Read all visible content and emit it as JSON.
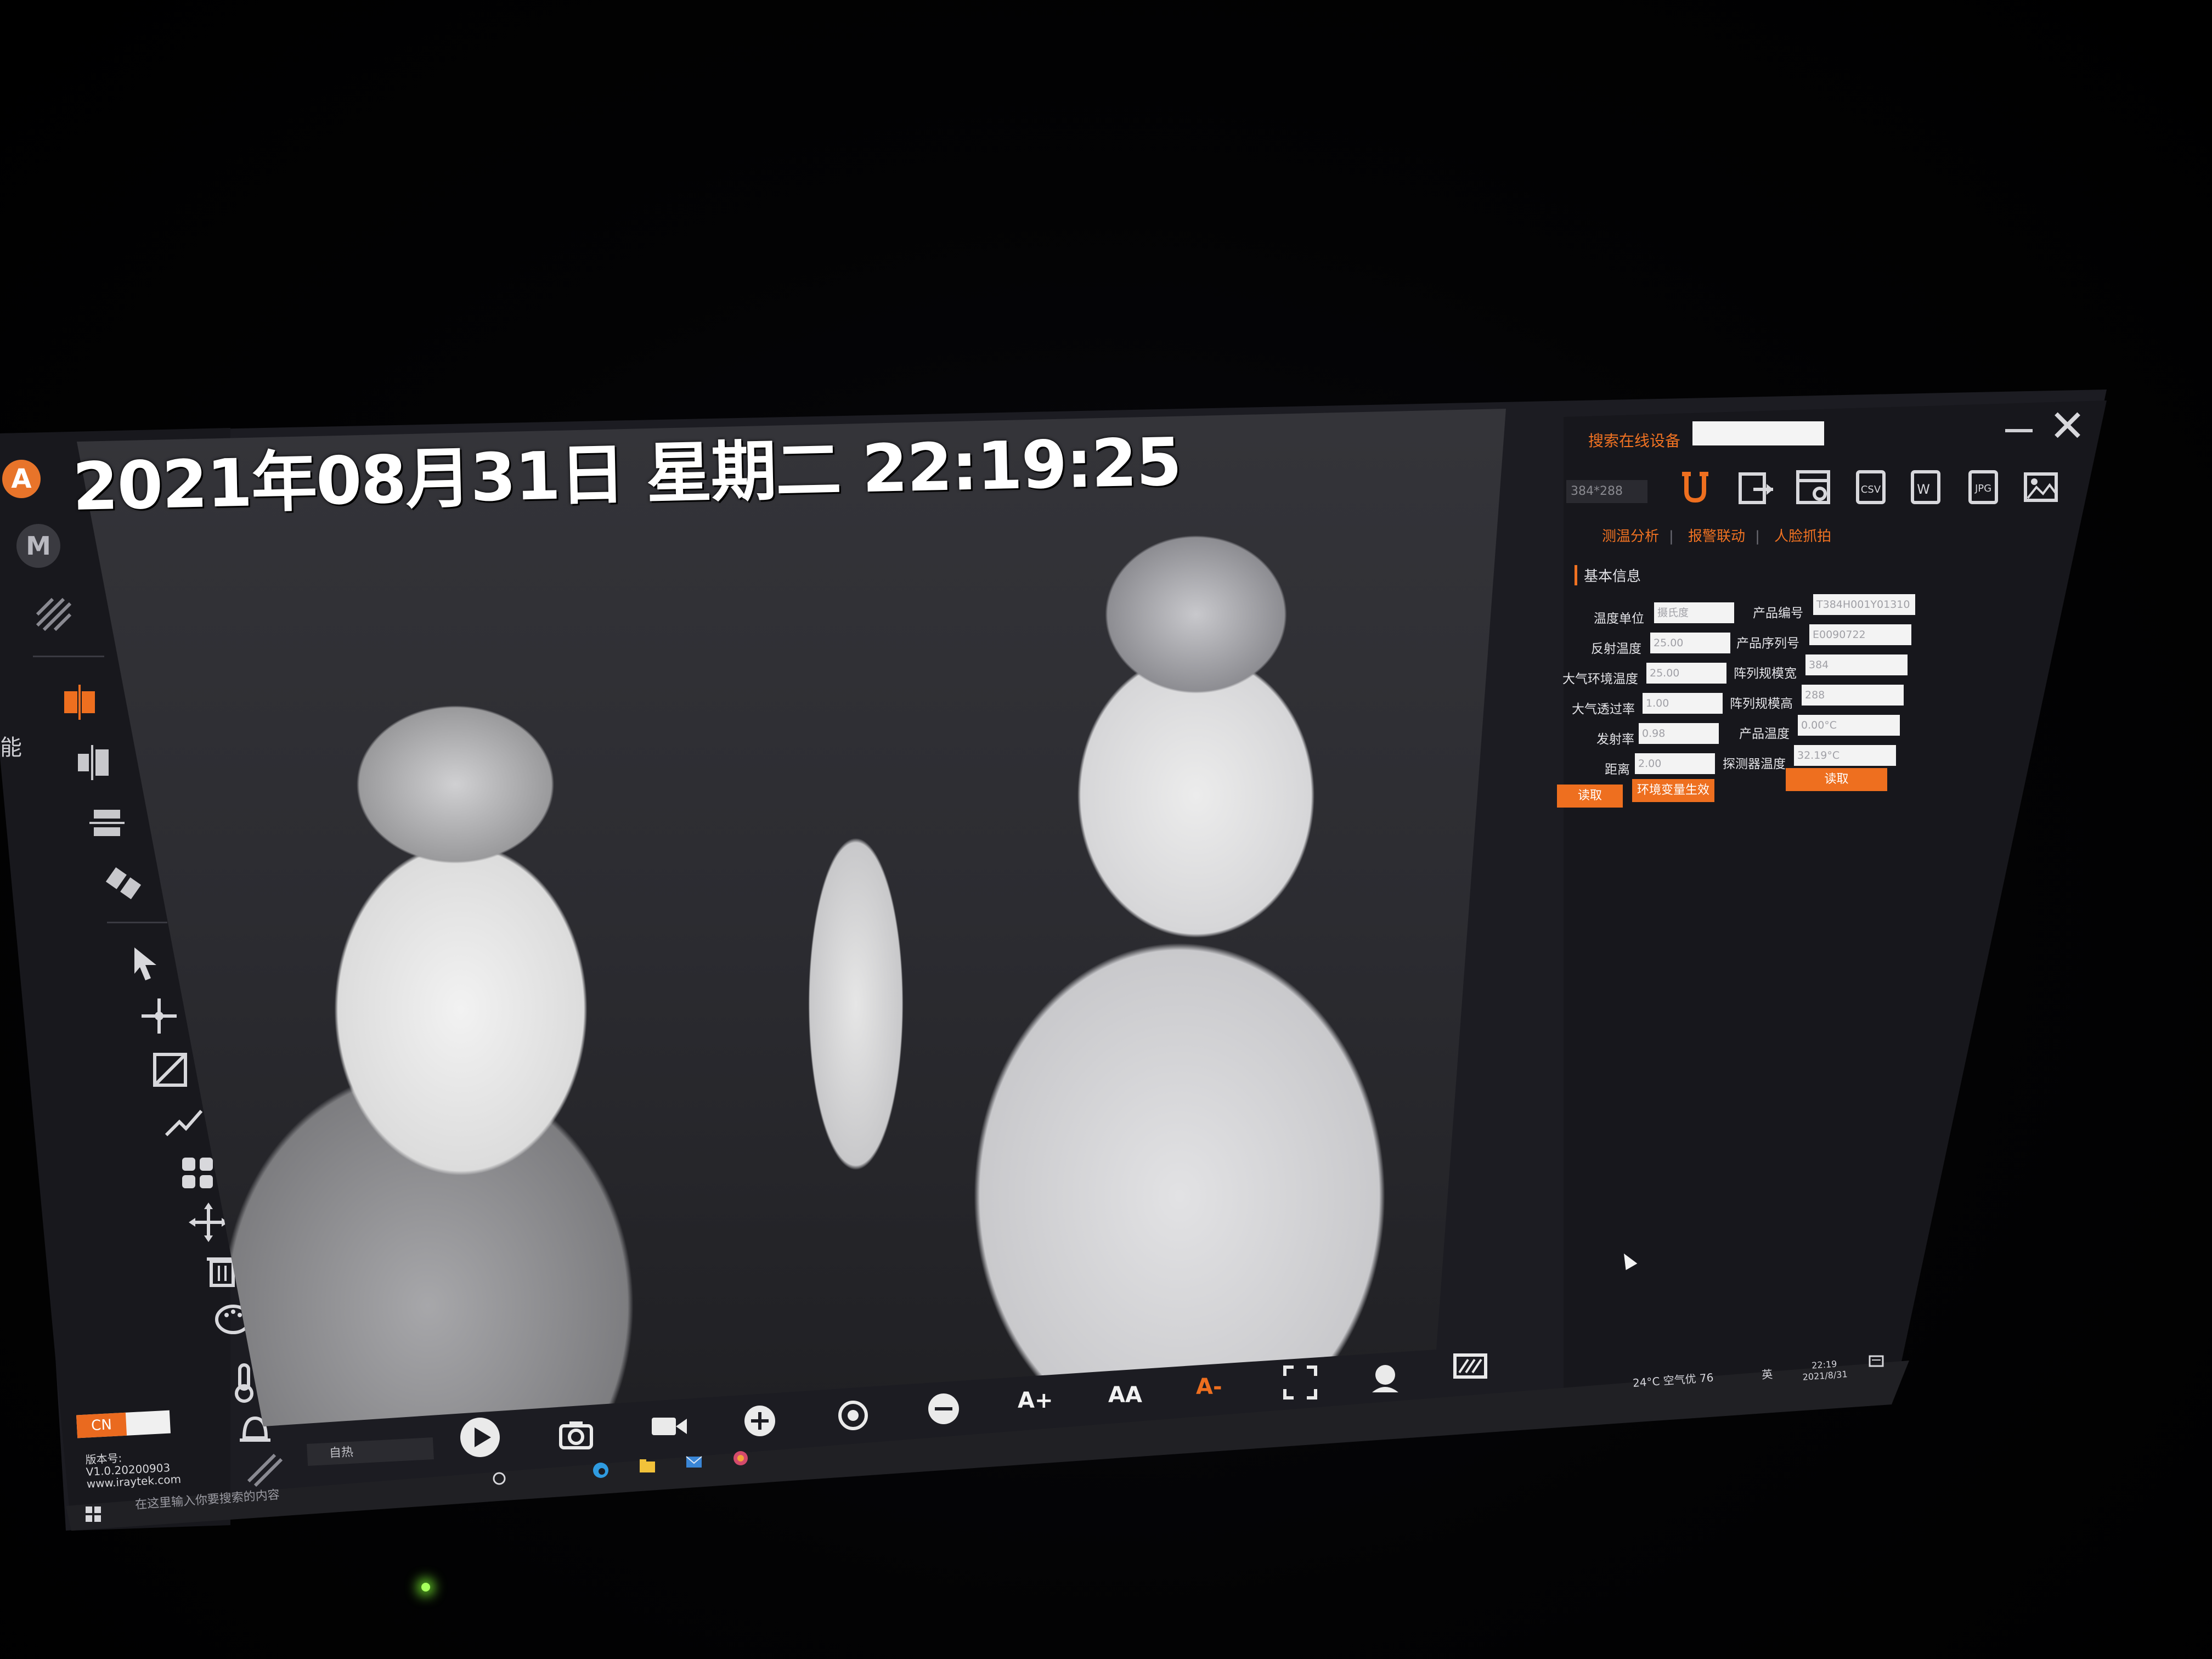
{
  "feed": {
    "timestamp": "2021年08月31日 星期二 22:19:25"
  },
  "left_toolbar": {
    "app_badge": "A",
    "mode_badge": "M",
    "side_label": "能",
    "lang_label": "CN",
    "version_label": "版本号:",
    "version_number": "V1.0.20200903",
    "website": "www.iraytek.com",
    "tools": [
      "split-view-icon",
      "split-vertical-icon",
      "split-horizontal-icon",
      "tiles-icon",
      "pointer-icon",
      "crosshair-icon",
      "area-box-icon",
      "line-icon",
      "grid-icon",
      "move-icon",
      "trash-icon",
      "palette-icon",
      "thermometer-icon",
      "alarm-icon"
    ]
  },
  "panel": {
    "search_label": "搜索在线设备",
    "search_value": "",
    "ip_value": "384*288",
    "tabs": [
      "测温分析",
      "报警联动",
      "人脸抓拍"
    ],
    "section_title": "基本信息",
    "left_fields": [
      {
        "label": "温度单位",
        "value": "摄氏度"
      },
      {
        "label": "反射温度",
        "value": "25.00"
      },
      {
        "label": "大气环境温度",
        "value": "25.00"
      },
      {
        "label": "大气透过率",
        "value": "1.00"
      },
      {
        "label": "发射率",
        "value": "0.98"
      },
      {
        "label": "距离",
        "value": "2.00"
      }
    ],
    "right_fields": [
      {
        "label": "产品编号",
        "value": "T384H001Y01310"
      },
      {
        "label": "产品序列号",
        "value": "E0090722"
      },
      {
        "label": "阵列规模宽",
        "value": "384"
      },
      {
        "label": "阵列规模高",
        "value": "288"
      },
      {
        "label": "产品温度",
        "value": "0.00°C"
      },
      {
        "label": "探测器温度",
        "value": "32.19°C"
      }
    ],
    "btn_read_left": "读取",
    "btn_apply_env": "环境变量生效",
    "btn_read_right": "读取",
    "tool_icons": [
      "usb-connect-icon",
      "export-icon",
      "settings-list-icon",
      "csv-icon",
      "word-icon",
      "jpg-icon",
      "image-icon"
    ]
  },
  "bottom_controls": {
    "mode_value": "自热",
    "zoom_in_text": "A+",
    "font_text": "AA",
    "zoom_out_text": "A-"
  },
  "taskbar": {
    "search_placeholder": "在这里输入你要搜索的内容",
    "weather": "24°C 空气优 76",
    "ime": "英",
    "time": "22:19",
    "date": "2021/8/31"
  },
  "colors": {
    "accent": "#ee6f1f",
    "panel_bg": "#17171c",
    "text_light": "#e4e4e8"
  }
}
